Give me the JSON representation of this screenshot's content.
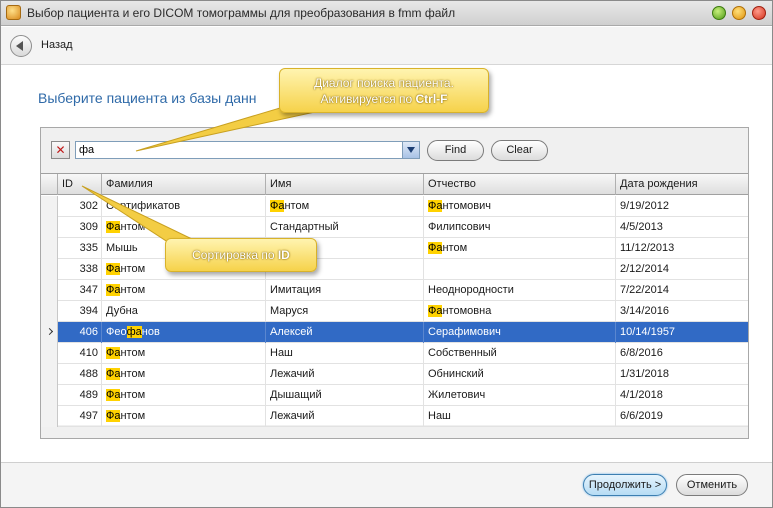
{
  "window": {
    "title": "Выбор пациента и его DICOM томограммы  для преобразования в fmm файл"
  },
  "nav": {
    "back_label": "Назад"
  },
  "main": {
    "heading": "Выберите пациента из базы данн"
  },
  "search": {
    "value": "фа",
    "find_label": "Find",
    "clear_label": "Clear"
  },
  "callouts": {
    "search_line1": "Диалог поиска пациента.",
    "search_line2_prefix": "Активируется по ",
    "search_line2_key": "Ctrl-F",
    "sort_prefix": "Сортировка по ",
    "sort_key": "ID"
  },
  "grid": {
    "columns": [
      "ID",
      "Фамилия",
      "Имя",
      "Отчество",
      "Дата рождения"
    ],
    "sort": {
      "column": "ID",
      "direction": "ascending"
    },
    "highlight_color": "#ffd200",
    "selection_color": "#316ac5",
    "rows": [
      {
        "id": "302",
        "last": [
          "Сертификатов"
        ],
        "first": [
          "",
          "Фа",
          "нтом"
        ],
        "middle": [
          "",
          "Фа",
          "нтомович"
        ],
        "dob": "9/19/2012"
      },
      {
        "id": "309",
        "last": [
          "",
          "Фа",
          "нтом"
        ],
        "first": [
          "Стандартный"
        ],
        "middle": [
          "Филипсович"
        ],
        "dob": "4/5/2013"
      },
      {
        "id": "335",
        "last": [
          "Мышь"
        ],
        "first": [
          ""
        ],
        "middle": [
          "",
          "Фа",
          "нтом"
        ],
        "dob": "11/12/2013"
      },
      {
        "id": "338",
        "last": [
          "",
          "Фа",
          "нтом"
        ],
        "first": [
          ""
        ],
        "middle": [
          ""
        ],
        "dob": "2/12/2014"
      },
      {
        "id": "347",
        "last": [
          "",
          "Фа",
          "нтом"
        ],
        "first": [
          "Имитация"
        ],
        "middle": [
          "Неоднородности"
        ],
        "dob": "7/22/2014"
      },
      {
        "id": "394",
        "last": [
          "Дубна"
        ],
        "first": [
          "Маруся"
        ],
        "middle": [
          "",
          "Фа",
          "нтомовна"
        ],
        "dob": "3/14/2016"
      },
      {
        "id": "406",
        "last": [
          "Фео",
          "фа",
          "нов"
        ],
        "first": [
          "Алексей"
        ],
        "middle": [
          "Серафимович"
        ],
        "dob": "10/14/1957",
        "selected": true
      },
      {
        "id": "410",
        "last": [
          "",
          "Фа",
          "нтом"
        ],
        "first": [
          "Наш"
        ],
        "middle": [
          "Собственный"
        ],
        "dob": "6/8/2016"
      },
      {
        "id": "488",
        "last": [
          "",
          "Фа",
          "нтом"
        ],
        "first": [
          "Лежачий"
        ],
        "middle": [
          "Обнинский"
        ],
        "dob": "1/31/2018"
      },
      {
        "id": "489",
        "last": [
          "",
          "Фа",
          "нтом"
        ],
        "first": [
          "Дышащий"
        ],
        "middle": [
          "Жилетович"
        ],
        "dob": "4/1/2018"
      },
      {
        "id": "497",
        "last": [
          "",
          "Фа",
          "нтом"
        ],
        "first": [
          "Лежачий"
        ],
        "middle": [
          "Наш"
        ],
        "dob": "6/6/2019"
      }
    ]
  },
  "footer": {
    "continue_label": "Продолжить >",
    "cancel_label": "Отменить"
  }
}
